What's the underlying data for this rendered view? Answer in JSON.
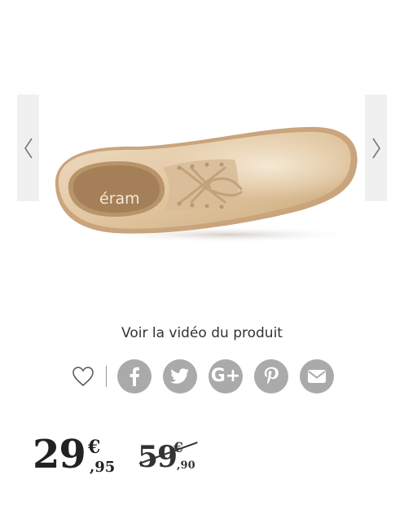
{
  "product": {
    "brand": "éram",
    "video_link": "Voir la vidéo du produit"
  },
  "gallery": {
    "prev_icon": "chevron-left-icon",
    "next_icon": "chevron-right-icon"
  },
  "share": {
    "wishlist_icon": "heart-icon",
    "facebook_icon": "facebook-icon",
    "twitter_icon": "twitter-icon",
    "googleplus_icon": "google-plus-icon",
    "googleplus_label": "G+",
    "pinterest_icon": "pinterest-icon",
    "email_icon": "email-icon"
  },
  "price": {
    "current_int": "29",
    "current_currency": "€",
    "current_cents": ",95",
    "old_int": "59",
    "old_currency": "€",
    "old_cents": ",90"
  },
  "colors": {
    "social_button": "#aaaaaa",
    "arrow_bg": "#f0f0f0",
    "text": "#333333"
  }
}
